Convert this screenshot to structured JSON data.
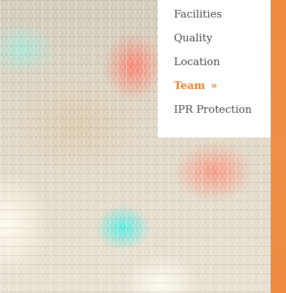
{
  "nav": {
    "items": [
      {
        "label": "Facilities"
      },
      {
        "label": "Quality"
      },
      {
        "label": "Location"
      },
      {
        "label": "Team",
        "active": true,
        "indicator": "»"
      },
      {
        "label": "IPR Protection"
      }
    ]
  },
  "colors": {
    "accent": "#ea7f2c",
    "strip": "#ef8a3d",
    "text": "#4b4744",
    "panel": "#ffffff"
  },
  "icons": {
    "active_indicator": "chevron-double-right-icon"
  }
}
